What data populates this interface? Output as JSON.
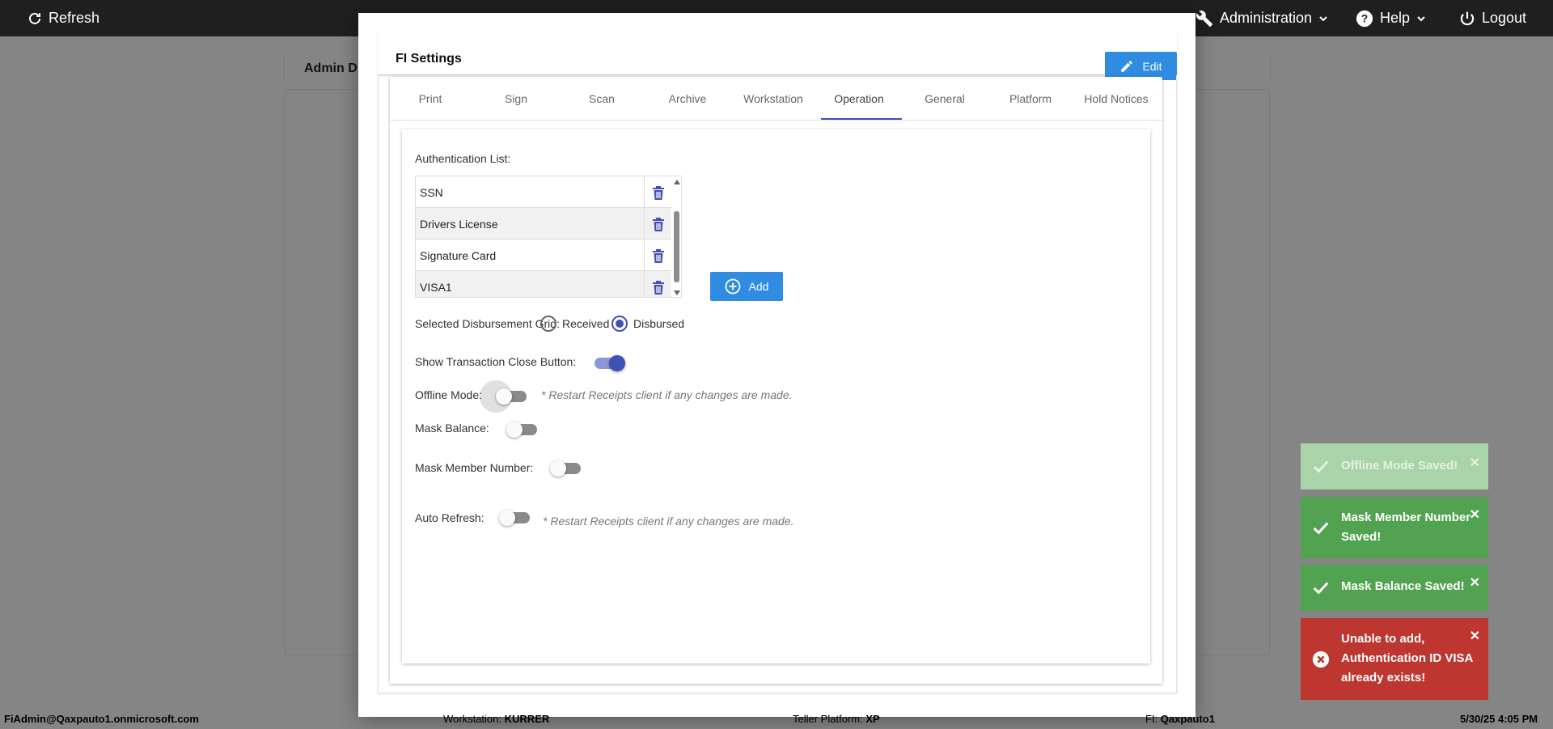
{
  "topbar": {
    "refresh_label": "Refresh",
    "administration_label": "Administration",
    "help_label": "Help",
    "logout_label": "Logout"
  },
  "background": {
    "header_title": "Admin D"
  },
  "modal": {
    "title": "FI Settings",
    "edit_label": "Edit",
    "tabs": [
      "Print",
      "Sign",
      "Scan",
      "Archive",
      "Workstation",
      "Operation",
      "General",
      "Platform",
      "Hold Notices"
    ],
    "active_tab": "Operation",
    "operation": {
      "authentication_list_label": "Authentication List:",
      "authentication_items": [
        "SSN",
        "Drivers License",
        "Signature Card",
        "VISA1"
      ],
      "add_label": "Add",
      "disbursement_grid_label": "Selected Disbursement Grid:",
      "disbursement_options": [
        "Received",
        "Disbursed"
      ],
      "disbursement_selected": "Disbursed",
      "show_close_button_label": "Show Transaction Close Button:",
      "show_close_button_on": true,
      "offline_mode_label": "Offline Mode:",
      "offline_mode_on": false,
      "offline_mode_note": "* Restart Receipts client if any changes are made.",
      "mask_balance_label": "Mask Balance:",
      "mask_balance_on": false,
      "mask_member_label": "Mask Member Number:",
      "mask_member_on": false,
      "auto_refresh_label": "Auto Refresh:",
      "auto_refresh_on": false,
      "auto_refresh_note": "* Restart Receipts client if any changes are made."
    }
  },
  "toasts": [
    {
      "text": "Offline Mode Saved!",
      "type": "success-fading"
    },
    {
      "text": "Mask Member Number Saved!",
      "type": "success"
    },
    {
      "text": "Mask Balance Saved!",
      "type": "success"
    },
    {
      "text": "Unable to add, Authentication ID VISA already exists!",
      "type": "error"
    }
  ],
  "colors": {
    "primary_blue": "#2f8ce0",
    "indigo": "#3f51b5",
    "success_green": "#4caf50",
    "error_red": "#d32f2f"
  },
  "statusbar": {
    "user": "FiAdmin@Qaxpauto1.onmicrosoft.com",
    "workstation_label": "Workstation:",
    "workstation_value": "KURRER",
    "platform_label": "Teller Platform:",
    "platform_value": "XP",
    "fi_label": "FI:",
    "fi_value": "Qaxpauto1",
    "datetime": "5/30/25 4:05 PM"
  }
}
